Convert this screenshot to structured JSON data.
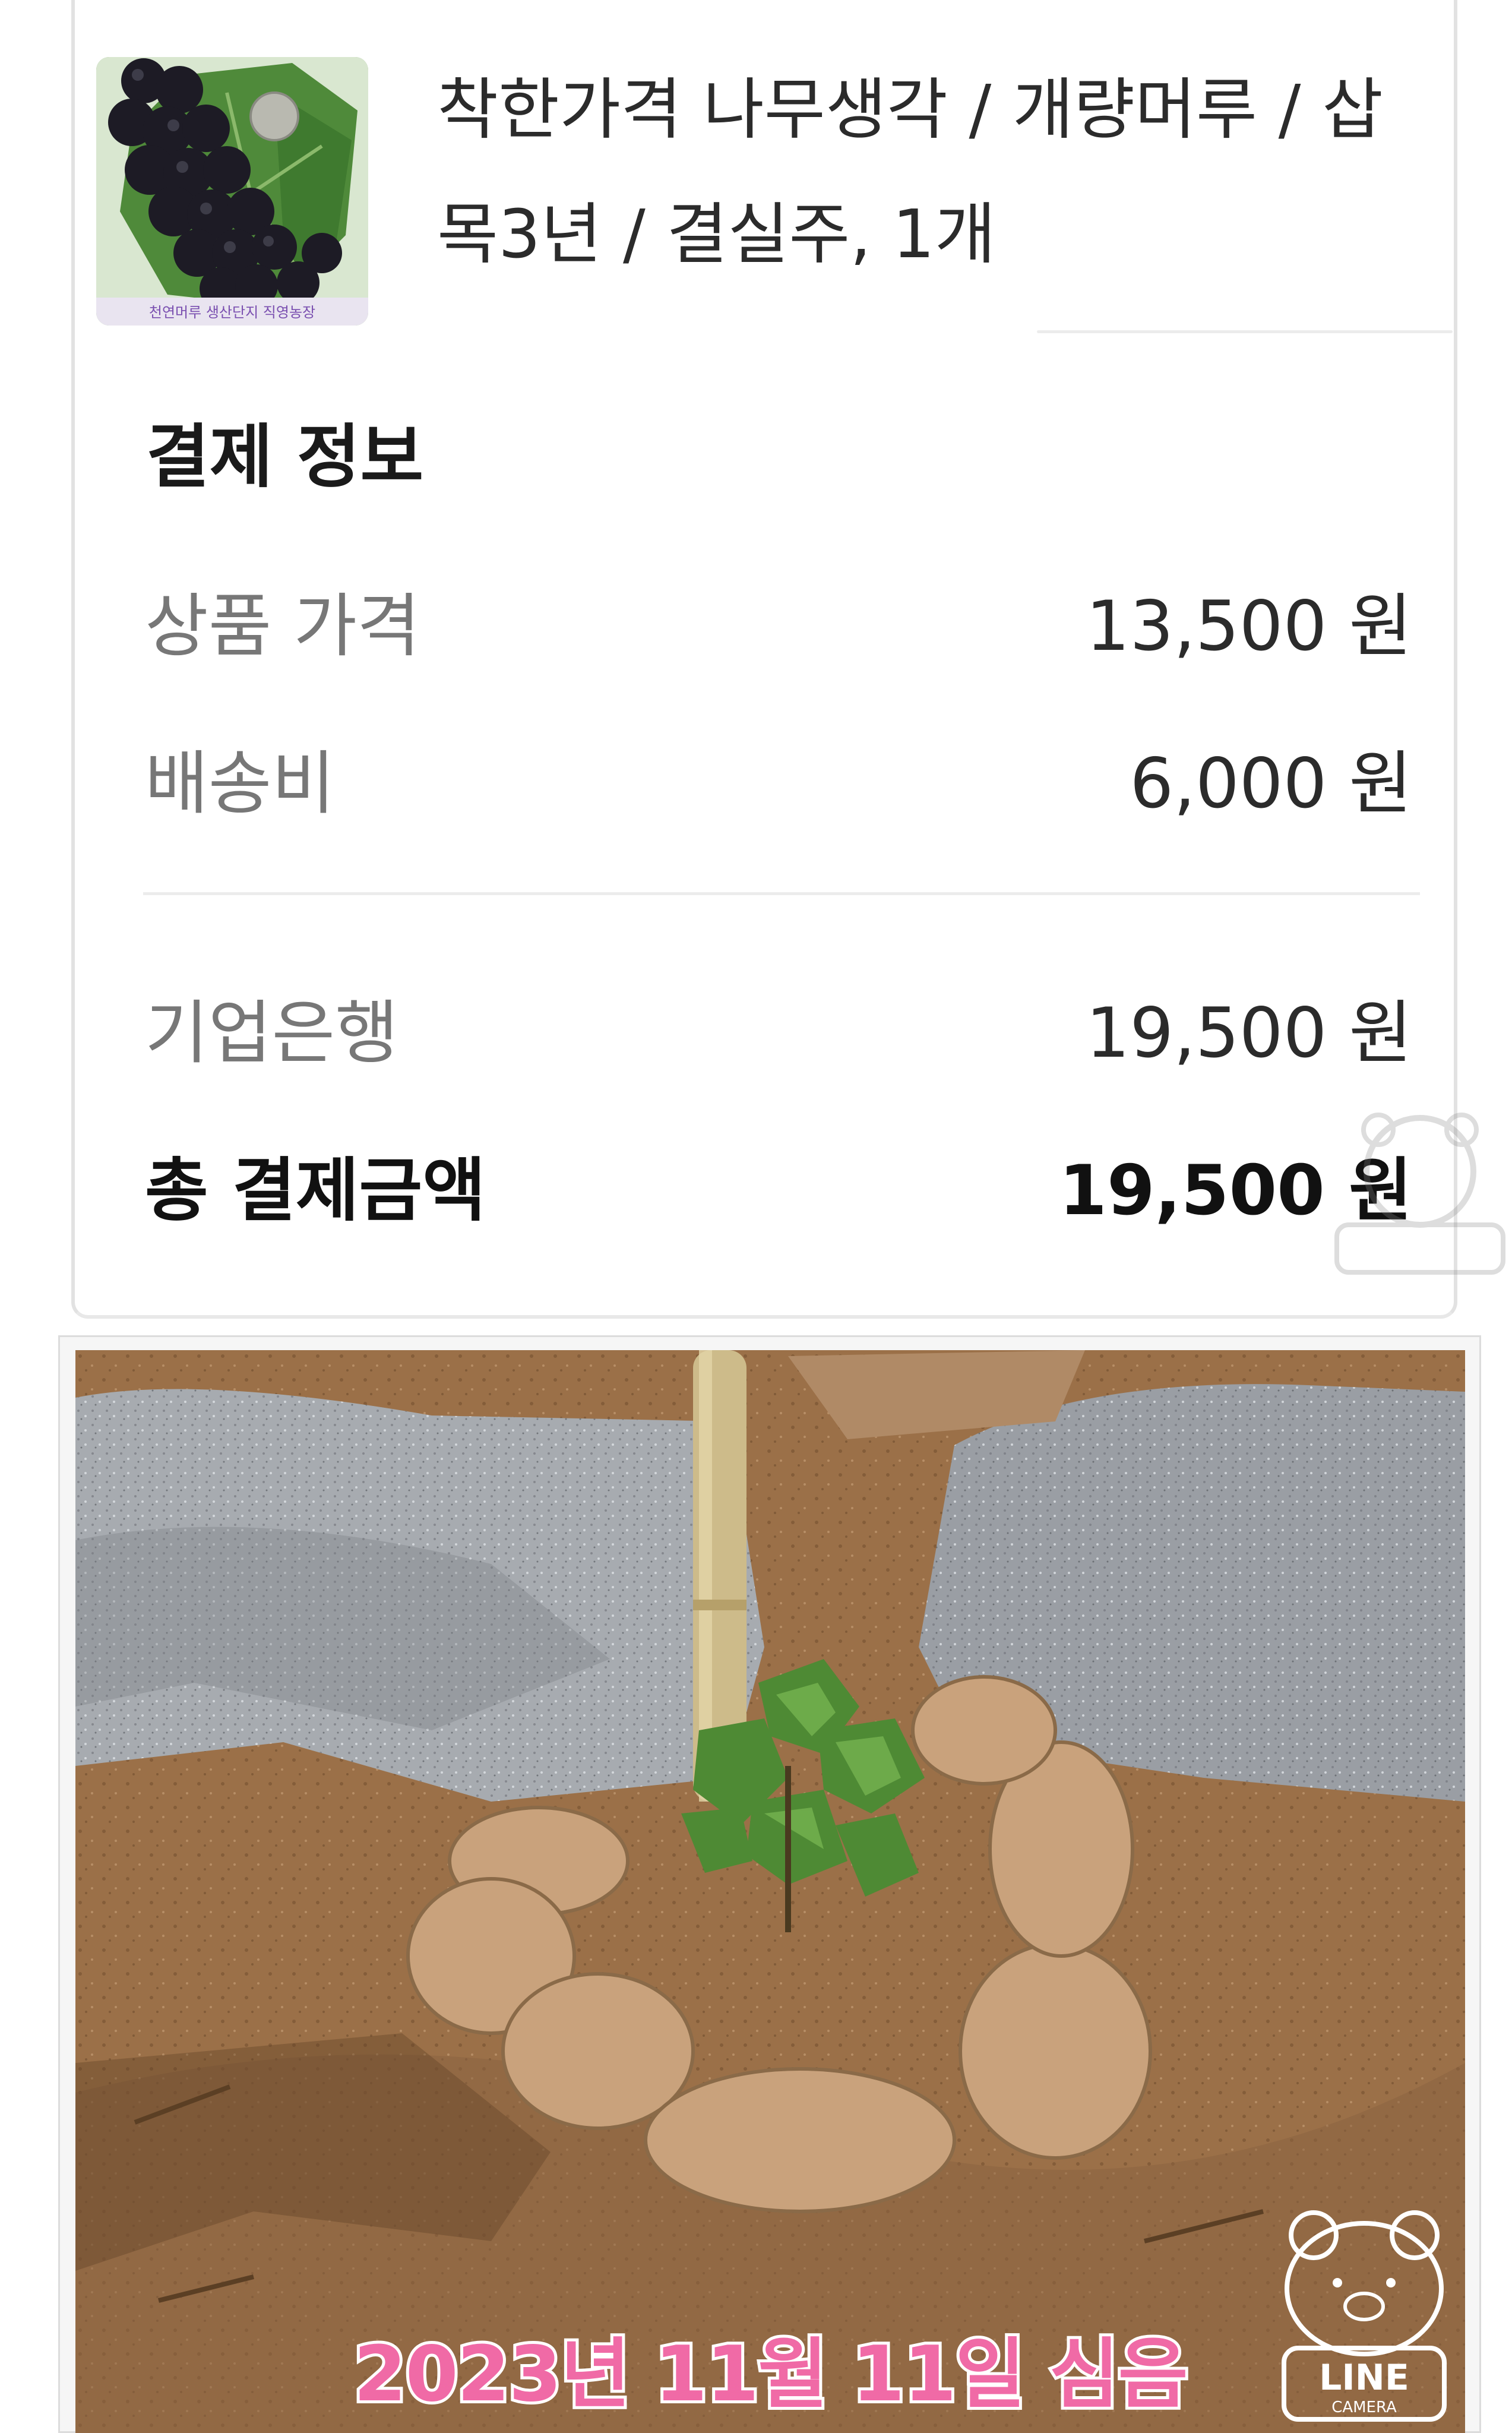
{
  "product": {
    "title_line1": "착한가격 나무생각 / 개량머루 / 삽",
    "title_line2": "목3년 / 결실주, 1개",
    "thumbnail_caption": "천연머루 생산단지 직영농장"
  },
  "payment": {
    "heading": "결제 정보",
    "rows": [
      {
        "label": "상품 가격",
        "value": "13,500 원"
      },
      {
        "label": "배송비",
        "value": "6,000 원"
      }
    ],
    "method": {
      "label": "기업은행",
      "value": "19,500 원"
    },
    "total": {
      "label": "총 결제금액",
      "value": "19,500 원"
    }
  },
  "photo": {
    "caption": "2023년 11월 11일 심음",
    "watermark_text": "LINE",
    "watermark_sub": "CAMERA"
  },
  "colors": {
    "caption_pink": "#f06aa6",
    "text_dark": "#111111",
    "text_gray": "#777777"
  }
}
